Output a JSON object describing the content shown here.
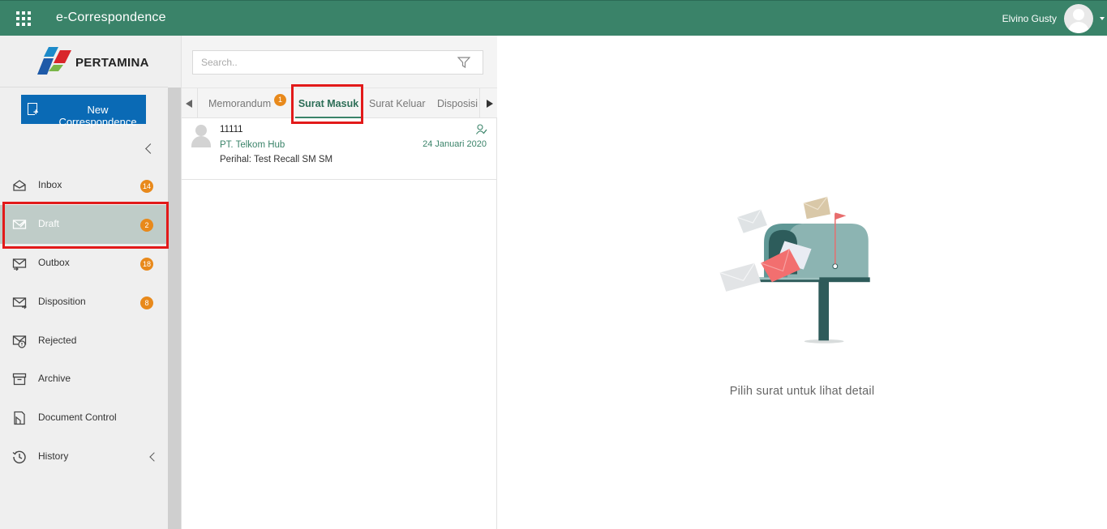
{
  "header": {
    "app_title": "e-Correspondence",
    "user_name": "Elvino Gusty",
    "apps_icon": "grid-apps-icon",
    "brand_color": "#3a8369"
  },
  "sidebar": {
    "logo_text": "PERTAMINA",
    "new_button_label": "New Correspondence",
    "items": [
      {
        "label": "Inbox",
        "icon": "inbox-icon",
        "badge": "14"
      },
      {
        "label": "Draft",
        "icon": "draft-icon",
        "badge": "2",
        "active": true
      },
      {
        "label": "Outbox",
        "icon": "outbox-icon",
        "badge": "18"
      },
      {
        "label": "Disposition",
        "icon": "disposition-icon",
        "badge": "8"
      },
      {
        "label": "Rejected",
        "icon": "rejected-icon"
      },
      {
        "label": "Archive",
        "icon": "archive-icon"
      },
      {
        "label": "Document Control",
        "icon": "document-control-icon"
      },
      {
        "label": "History",
        "icon": "history-icon"
      }
    ]
  },
  "list": {
    "search_placeholder": "Search..",
    "tabs": [
      {
        "label": "Memorandum",
        "badge": "1"
      },
      {
        "label": "Surat Masuk",
        "active": true
      },
      {
        "label": "Surat Keluar"
      },
      {
        "label": "Disposisi"
      }
    ],
    "items": [
      {
        "number": "11111",
        "sender": "PT. Telkom Hub",
        "subject": "Perihal: Test Recall SM SM",
        "date": "24 Januari 2020"
      }
    ]
  },
  "detail": {
    "empty_message": "Pilih surat untuk lihat detail",
    "illustration": "mailbox-illustration"
  },
  "colors": {
    "primary_button": "#0a6ab5",
    "badge": "#e8891b",
    "highlight_box": "#e21a1a",
    "active_nav": "#bfccc8"
  }
}
